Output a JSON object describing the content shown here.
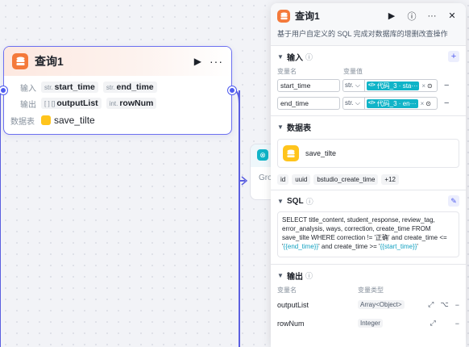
{
  "canvas": {
    "node": {
      "title": "查询1",
      "inputs_label": "输入",
      "outputs_label": "输出",
      "table_label": "数据表",
      "inputs": [
        {
          "type": "str.",
          "name": "start_time"
        },
        {
          "type": "str.",
          "name": "end_time"
        }
      ],
      "outputs": [
        {
          "type": "[ ] []",
          "name": "outputList"
        },
        {
          "type": "int.",
          "name": "rowNum"
        }
      ],
      "table": "save_tilte"
    },
    "node2": {
      "text": "Gro"
    }
  },
  "panel": {
    "title": "查询1",
    "description": "基于用户自定义的 SQL 完成对数据库的增删改查操作",
    "input_section": {
      "title": "输入",
      "col_name": "变量名",
      "col_value": "变量值",
      "rows": [
        {
          "name": "start_time",
          "type": "str.",
          "ref": "代码_3 · sta···"
        },
        {
          "name": "end_time",
          "type": "str.",
          "ref": "代码_3 · en···"
        }
      ]
    },
    "table_section": {
      "title": "数据表",
      "table": "save_tilte",
      "chips": [
        "id",
        "uuid",
        "bstudio_create_time",
        "+12"
      ]
    },
    "sql_section": {
      "title": "SQL",
      "sql_before": "SELECT title_content, student_response, review_tag, error_analysis, ways, correction, create_time  FROM save_tilte WHERE correction != '正确' and create_time <= '",
      "var1": "{{end_time}}",
      "sql_mid": "' and create_time >= '",
      "var2": "{{start_time}}",
      "sql_end": "'"
    },
    "output_section": {
      "title": "输出",
      "col_name": "变量名",
      "col_type": "变量类型",
      "rows": [
        {
          "name": "outputList",
          "type": "Array<Object>"
        },
        {
          "name": "rowNum",
          "type": "Integer"
        }
      ]
    }
  }
}
